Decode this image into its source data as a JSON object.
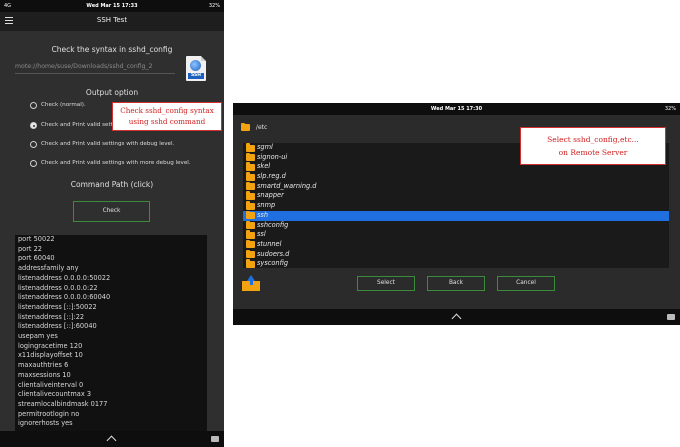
{
  "left": {
    "status": {
      "left": "4G",
      "time": "Wed Mar 15  17:33",
      "battery": "32%"
    },
    "app_title": "SSH Test",
    "menu_icon": "hamburger-icon",
    "syntax_header": "Check the syntax in sshd_config",
    "path_value": "mote://home/suse/Downloads/sshd_config_2",
    "file_icon": "ssh-file-icon",
    "file_icon_label": "SSH",
    "output_header": "Output option",
    "options": [
      {
        "label": "Check (normal).",
        "selected": false
      },
      {
        "label": "Check and Print valid settings.",
        "selected": true
      },
      {
        "label": "Check and Print valid settings with debug level.",
        "selected": false
      },
      {
        "label": "Check and Print valid settings with more debug level.",
        "selected": false
      }
    ],
    "callout_line1": "Check sshd_config syntax",
    "callout_line2": "using sshd command",
    "command_path_label": "Command Path (click)",
    "check_button": "Check",
    "output_lines": [
      "port 50022",
      "port 22",
      "port 60040",
      "addressfamily any",
      "listenaddress 0.0.0.0:50022",
      "listenaddress 0.0.0.0:22",
      "listenaddress 0.0.0.0:60040",
      "listenaddress [::]:50022",
      "listenaddress [::]:22",
      "listenaddress [::]:60040",
      "usepam yes",
      "logingracetime 120",
      "x11displayoffset 10",
      "maxauthtries 6",
      "maxsessions 10",
      "clientaliveinterval 0",
      "clientalivecountmax 3",
      "streamlocalbindmask 0177",
      "permitrootlogin no",
      "ignorerhosts yes"
    ]
  },
  "right": {
    "status": {
      "time": "Wed Mar 15  17:30",
      "battery": "32%"
    },
    "current_dir": "/etc",
    "callout_line1": "Select sshd_config,etc...",
    "callout_line2": "on Remote Server",
    "folders": [
      {
        "name": "sgml",
        "selected": false
      },
      {
        "name": "signon-ui",
        "selected": false
      },
      {
        "name": "skel",
        "selected": false
      },
      {
        "name": "slp.reg.d",
        "selected": false
      },
      {
        "name": "smartd_warning.d",
        "selected": false
      },
      {
        "name": "snapper",
        "selected": false
      },
      {
        "name": "snmp",
        "selected": false
      },
      {
        "name": "ssh",
        "selected": true
      },
      {
        "name": "sshconfig",
        "selected": false
      },
      {
        "name": "ssl",
        "selected": false
      },
      {
        "name": "stunnel",
        "selected": false
      },
      {
        "name": "sudoers.d",
        "selected": false
      },
      {
        "name": "sysconfig",
        "selected": false
      }
    ],
    "buttons": {
      "select": "Select",
      "back": "Back",
      "cancel": "Cancel"
    },
    "up_icon": "folder-up-icon"
  },
  "colors": {
    "accent_blue": "#1f6fe0",
    "folder": "#f2a30f",
    "callout_red": "#d02020",
    "button_border": "#3c8a3c"
  }
}
